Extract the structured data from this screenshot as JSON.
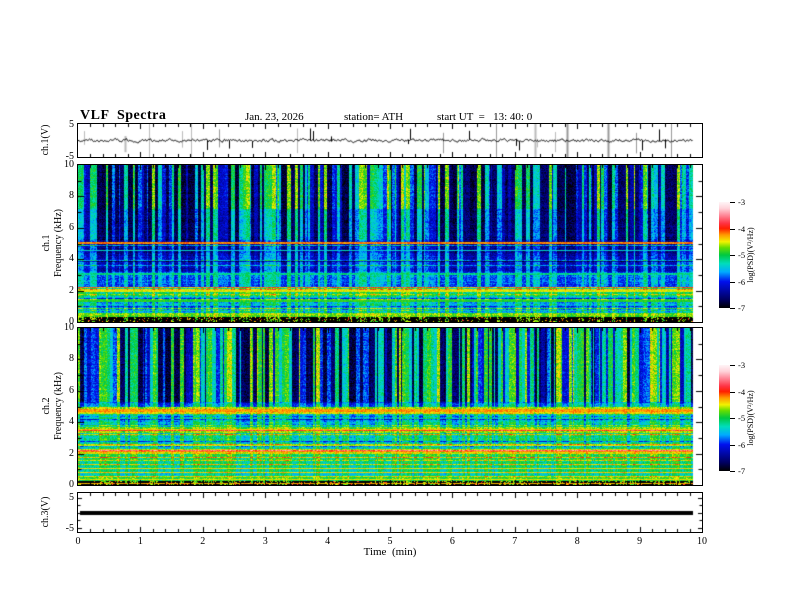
{
  "header": {
    "title": "VLF  Spectra",
    "date": "Jan. 23, 2026",
    "station": "station= ATH",
    "start_ut": "start UT  =   13: 40: 0"
  },
  "panels": {
    "ch1_wave": {
      "ylabel": "ch.1(V)",
      "yticks": [
        "5",
        "-5"
      ]
    },
    "ch1_spec": {
      "ylabel_ch": "ch.1",
      "ylabel_freq": "Frequency  (kHz)",
      "yticks": [
        "10",
        "8",
        "6",
        "4",
        "2",
        "0"
      ]
    },
    "ch2_spec": {
      "ylabel_ch": "ch.2",
      "ylabel_freq": "Frequency  (kHz)",
      "yticks": [
        "10",
        "8",
        "6",
        "4",
        "2",
        "0"
      ]
    },
    "ch3_wave": {
      "ylabel": "ch.3(V)",
      "yticks": [
        "5",
        "-5"
      ]
    }
  },
  "xaxis": {
    "label": "Time  (min)",
    "ticks": [
      "0",
      "1",
      "2",
      "3",
      "4",
      "5",
      "6",
      "7",
      "8",
      "9",
      "10"
    ]
  },
  "colorbar": {
    "label": "log(PSD)(V²/Hz)",
    "ticks": [
      "-3",
      "-4",
      "-5",
      "-6",
      "-7"
    ]
  },
  "colors": {
    "background": "#ffffff",
    "frame": "#000000",
    "trace": "#000000",
    "colormap_stops": [
      {
        "t": 0.0,
        "c": "#000000"
      },
      {
        "t": 0.08,
        "c": "#000060"
      },
      {
        "t": 0.25,
        "c": "#0010ee"
      },
      {
        "t": 0.34,
        "c": "#00aaff"
      },
      {
        "t": 0.42,
        "c": "#00ddbb"
      },
      {
        "t": 0.5,
        "c": "#00c840"
      },
      {
        "t": 0.57,
        "c": "#66dd00"
      },
      {
        "t": 0.625,
        "c": "#f2f200"
      },
      {
        "t": 0.69,
        "c": "#ff9900"
      },
      {
        "t": 0.75,
        "c": "#ff1e00"
      },
      {
        "t": 0.8,
        "c": "#ff3344"
      },
      {
        "t": 0.875,
        "c": "#ff8899"
      },
      {
        "t": 0.94,
        "c": "#ffd3da"
      },
      {
        "t": 1.0,
        "c": "#fff5f7"
      }
    ]
  },
  "chart_data": [
    {
      "type": "line",
      "name": "ch1-waveform",
      "ylabel": "ch.1(V)",
      "xlim": [
        0,
        10
      ],
      "ylim": [
        -5,
        5
      ],
      "x_data_end_min": 9.8,
      "description": "Noisy broadband waveform centered near 0 V with impulsive spikes of roughly +-2 to +-4 V and occasional gray dropout bars"
    },
    {
      "type": "heatmap",
      "name": "ch1-spectrogram",
      "ylabel": "ch.1 Frequency (kHz)",
      "xlim": [
        0,
        10
      ],
      "ylim": [
        0,
        10
      ],
      "x_data_end_min": 9.8,
      "color_scale": {
        "label": "log(PSD)(V²/Hz)",
        "min": -7,
        "max": -3,
        "ticks": [
          -3,
          -4,
          -5,
          -6,
          -7
        ]
      },
      "features": [
        "dense vertical sferic striping above ~5 kHz alternating bright green/cyan and dark navy/black columns",
        "narrowband red horizontal line near 5 kHz",
        "blue/cyan broadband noise between 2 and 4.5 kHz with thin cyan horizontal lines",
        "bright green/yellow band near 1.6-2.2 kHz",
        "olive/yellow band near 0.3-0.55 kHz",
        "near-black below 0.3 kHz with bright speckles"
      ]
    },
    {
      "type": "heatmap",
      "name": "ch2-spectrogram",
      "ylabel": "ch.2 Frequency (kHz)",
      "xlim": [
        0,
        10
      ],
      "ylim": [
        0,
        10
      ],
      "x_data_end_min": 9.8,
      "color_scale": {
        "label": "log(PSD)(V²/Hz)",
        "min": -7,
        "max": -3,
        "ticks": [
          -3,
          -4,
          -5,
          -6,
          -7
        ]
      },
      "features": [
        "vertical sferic striping above ~5.3 kHz, brighter green than ch.1, with clusters of black columns",
        "dark red band near 4.55-4.95 kHz",
        "orange/red band near 3.3-3.7 kHz",
        "strong yellow/red band near 2.0-2.3 kHz",
        "green/cyan speckle with yellow harmonic lines between 0.6 and 3.3 kHz",
        "near-black below 0.25 kHz with a thin red line near 0.1 kHz"
      ]
    },
    {
      "type": "line",
      "name": "ch3-waveform",
      "ylabel": "ch.3(V)",
      "xlim": [
        0,
        10
      ],
      "ylim": [
        -5,
        5
      ],
      "x_data_end_min": 9.8,
      "description": "Constant flat thick black line at 0 V from 0 to ~9.8 min"
    }
  ]
}
